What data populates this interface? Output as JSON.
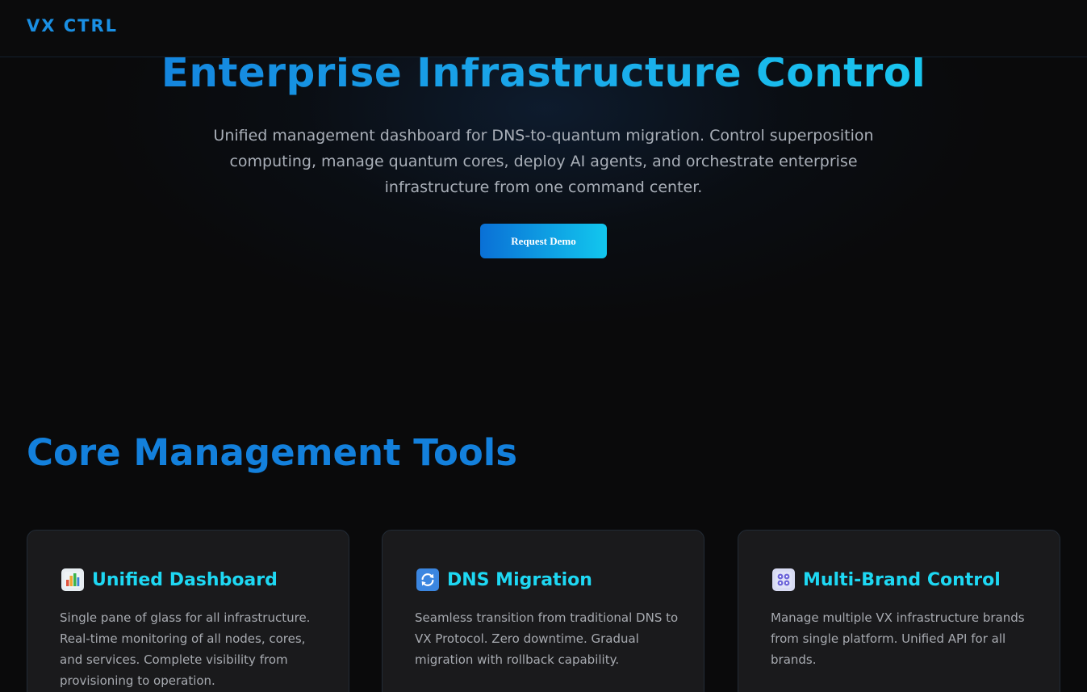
{
  "nav": {
    "logo": "VX CTRL"
  },
  "hero": {
    "title": "Enterprise Infrastructure Control",
    "subtitle": "Unified management dashboard for DNS-to-quantum migration. Control superposition computing, manage quantum cores, deploy AI agents, and orchestrate enterprise infrastructure from one command center.",
    "cta_label": "Request Demo"
  },
  "section": {
    "title": "Core Management Tools"
  },
  "cards": [
    {
      "icon": "bar-chart-icon",
      "title": "Unified Dashboard",
      "description": "Single pane of glass for all infrastructure. Real-time monitoring of all nodes, cores, and services. Complete visibility from provisioning to operation."
    },
    {
      "icon": "refresh-arrows-icon",
      "title": "DNS Migration",
      "description": "Seamless transition from traditional DNS to VX Protocol. Zero downtime. Gradual migration with rollback capability."
    },
    {
      "icon": "control-knobs-icon",
      "title": "Multi-Brand Control",
      "description": "Manage multiple VX infrastructure brands from single platform. Unified API for all brands."
    }
  ],
  "colors": {
    "background": "#0a0a0b",
    "accent_blue": "#1380dc",
    "accent_cyan": "#1ed8f3",
    "card_bg": "#1a1a1c"
  }
}
